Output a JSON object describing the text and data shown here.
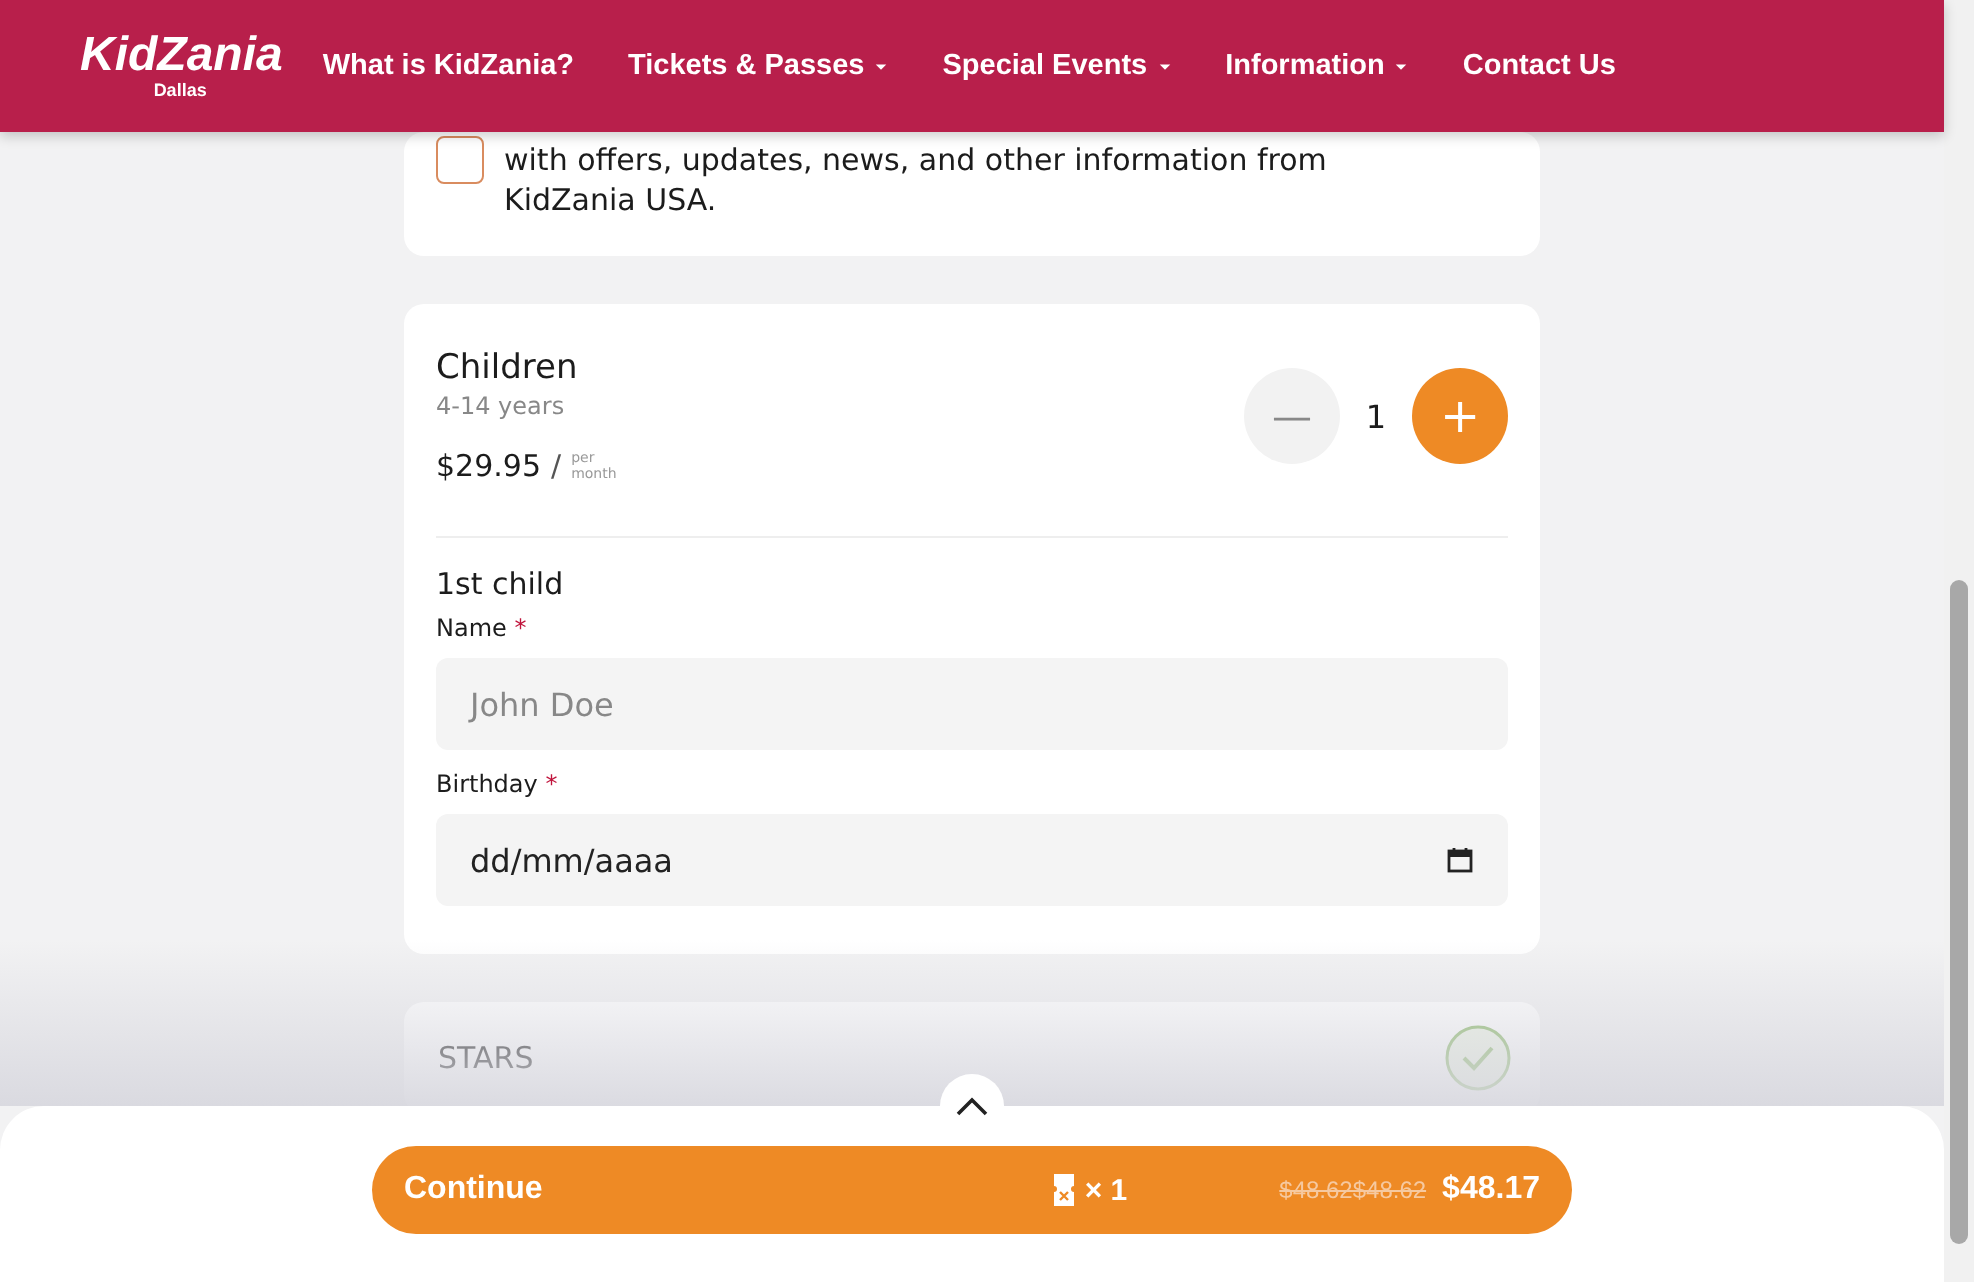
{
  "header": {
    "logo": "KidZania",
    "logo_sub": "Dallas",
    "nav": [
      {
        "label": "What is KidZania?",
        "dropdown": false
      },
      {
        "label": "Tickets & Passes",
        "dropdown": true
      },
      {
        "label": "Special Events",
        "dropdown": true
      },
      {
        "label": "Information",
        "dropdown": true
      },
      {
        "label": "Contact Us",
        "dropdown": false
      }
    ]
  },
  "consent": {
    "checked": false,
    "text": "with offers, updates, news, and other information from KidZania USA."
  },
  "ticket": {
    "title": "Children",
    "ages": "4-14 years",
    "price": "$29.95",
    "slash": "/",
    "per": "per",
    "period": "month",
    "minus": "—",
    "quantity": "1",
    "plus": "+"
  },
  "child": {
    "heading": "1st child",
    "fields": [
      {
        "label": "Name",
        "required": "*",
        "kind": "text",
        "placeholder": "John Doe"
      },
      {
        "label": "Birthday",
        "required": "*",
        "kind": "date",
        "placeholder": "dd/mm/aaaa"
      }
    ]
  },
  "stars": {
    "label": "STARS",
    "checked": true
  },
  "footer": {
    "button": "Continue",
    "count": "× 1",
    "old_price": "$48.62$48.62",
    "price": "$48.17"
  }
}
